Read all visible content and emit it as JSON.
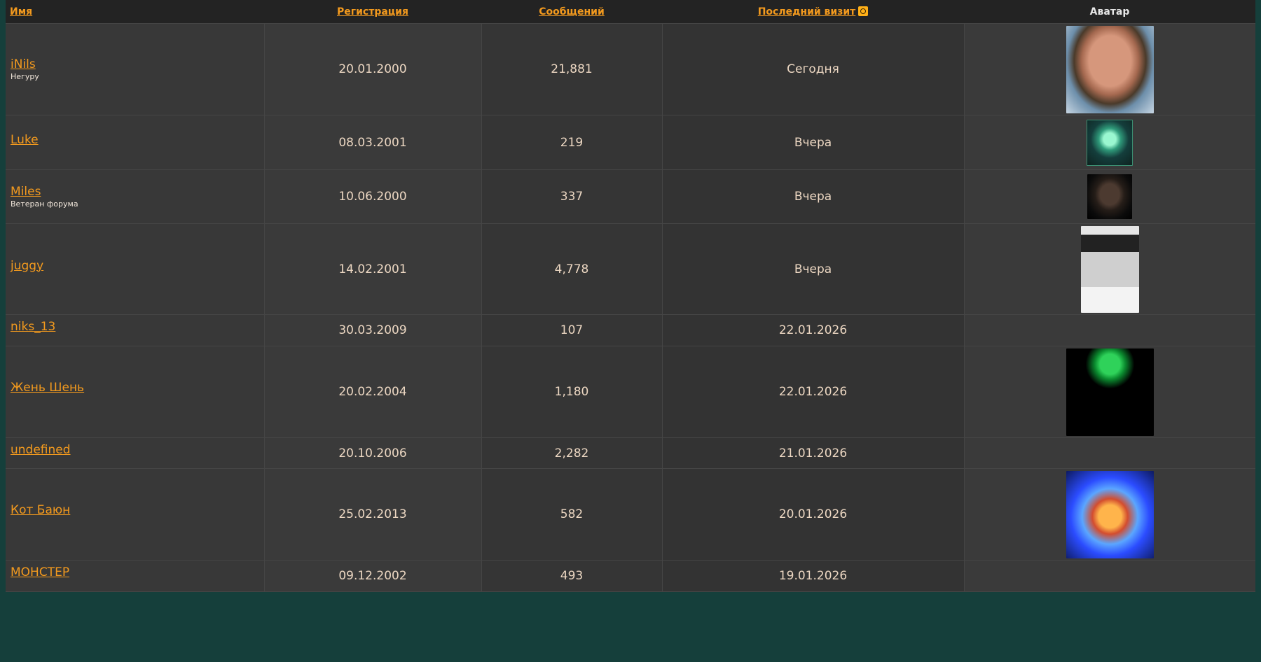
{
  "table": {
    "headers": {
      "name": "Имя",
      "registration": "Регистрация",
      "messages": "Сообщений",
      "last_visit": "Последний визит",
      "avatar": "Аватар"
    },
    "rows": [
      {
        "name": "iNils",
        "title": "Негуру",
        "registered": "20.01.2000",
        "messages": "21,881",
        "last_visit": "Сегодня",
        "avatar": "photo-bald-man-sunglasses"
      },
      {
        "name": "Luke",
        "title": "",
        "registered": "08.03.2001",
        "messages": "219",
        "last_visit": "Вчера",
        "avatar": "green-alien-luke"
      },
      {
        "name": "Miles",
        "title": "Ветеран форума",
        "registered": "10.06.2000",
        "messages": "337",
        "last_visit": "Вчера",
        "avatar": "dark-face-portrait"
      },
      {
        "name": "juggy",
        "title": "",
        "registered": "14.02.2001",
        "messages": "4,778",
        "last_visit": "Вчера",
        "avatar": "bw-man-hat"
      },
      {
        "name": "niks_13",
        "title": "",
        "registered": "30.03.2009",
        "messages": "107",
        "last_visit": "22.01.2026",
        "avatar": ""
      },
      {
        "name": "Жень Шень",
        "title": "",
        "registered": "20.02.2004",
        "messages": "1,180",
        "last_visit": "22.01.2026",
        "avatar": "ginseng-root-plant"
      },
      {
        "name": "undefined",
        "title": "",
        "registered": "20.10.2006",
        "messages": "2,282",
        "last_visit": "21.01.2026",
        "avatar": ""
      },
      {
        "name": "Кот Баюн",
        "title": "",
        "registered": "25.02.2013",
        "messages": "582",
        "last_visit": "20.01.2026",
        "avatar": "psychedelic-cat"
      },
      {
        "name": "МОНСТЕР",
        "title": "",
        "registered": "09.12.2002",
        "messages": "493",
        "last_visit": "19.01.2026",
        "avatar": ""
      }
    ]
  },
  "colors": {
    "accent": "#f39a1e",
    "text": "#ecd7c2",
    "background": "#353535",
    "header_bg": "#232323"
  }
}
